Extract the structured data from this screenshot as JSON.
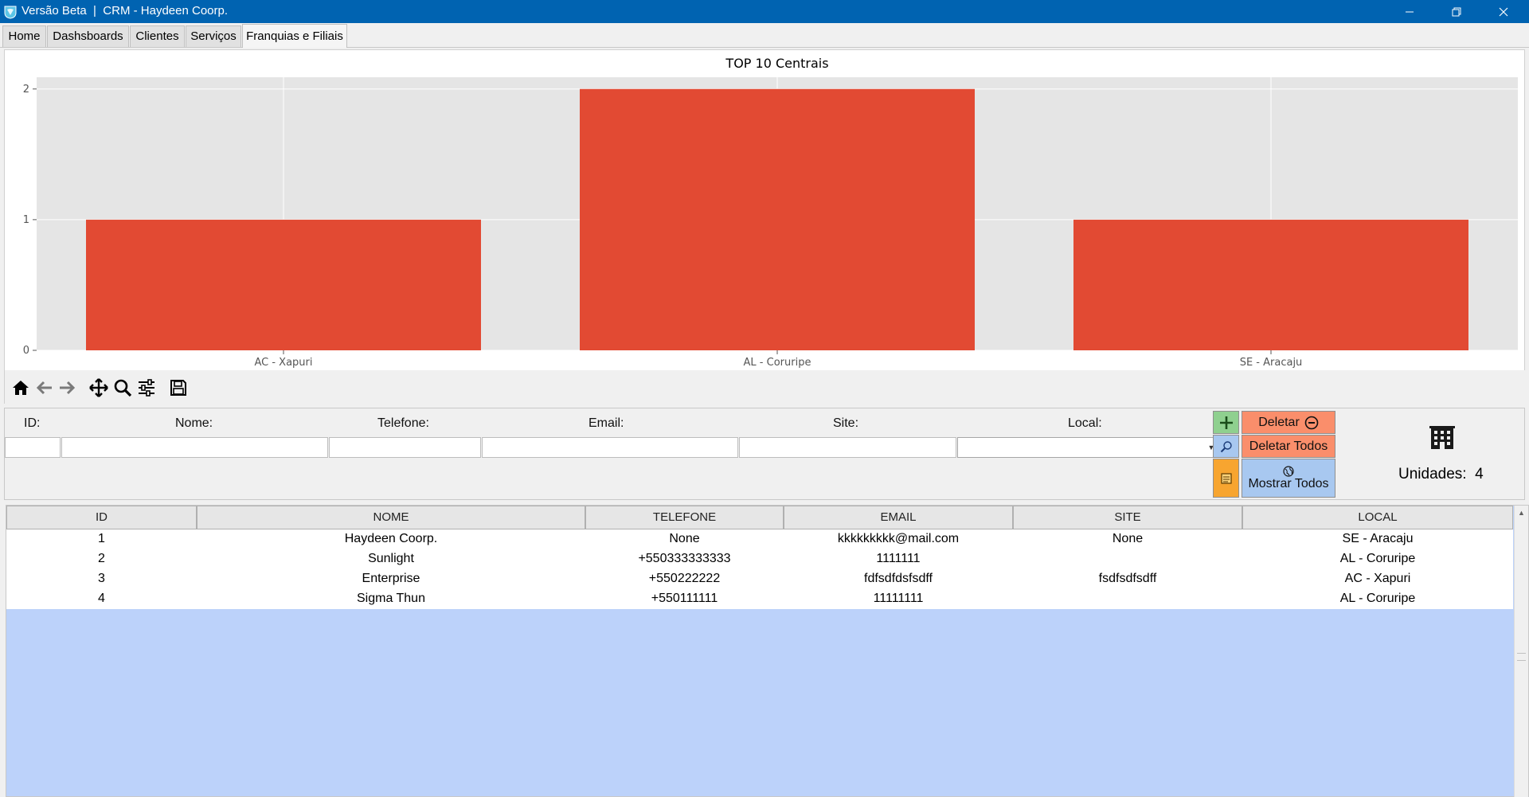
{
  "window": {
    "title": "Versão Beta  |  CRM - Haydeen Coorp.",
    "controls": [
      "minimize",
      "restore",
      "close"
    ]
  },
  "tabs": [
    {
      "label": "Home",
      "active": false
    },
    {
      "label": "Dashsboards",
      "active": false
    },
    {
      "label": "Clientes",
      "active": false
    },
    {
      "label": "Serviços",
      "active": false
    },
    {
      "label": "Franquias e Filiais",
      "active": true
    }
  ],
  "chart_data": {
    "type": "bar",
    "title": "TOP 10 Centrais",
    "categories": [
      "AC - Xapuri",
      "AL - Coruripe",
      "SE - Aracaju"
    ],
    "values": [
      1,
      2,
      1
    ],
    "yticks": [
      "0",
      "1",
      "2"
    ],
    "ylim": [
      0,
      2.09
    ],
    "xlabel": "",
    "ylabel": "",
    "grid": true,
    "bar_color": "#e24a33",
    "plot_background": "#e5e5e5"
  },
  "toolbar": {
    "icons": [
      "home-icon",
      "back-arrow-icon",
      "forward-arrow-icon",
      "pan-icon",
      "zoom-icon",
      "configure-subplots-icon",
      "save-icon"
    ]
  },
  "form": {
    "labels": {
      "id": "ID:",
      "nome": "Nome:",
      "telefone": "Telefone:",
      "email": "Email:",
      "site": "Site:",
      "local": "Local:"
    },
    "values": {
      "id": "",
      "nome": "",
      "telefone": "",
      "email": "",
      "site": "",
      "local": ""
    },
    "buttons": {
      "deletar": "Deletar",
      "deletar_todos": "Deletar Todos",
      "mostrar_todos": "Mostrar Todos"
    },
    "unidades_label": "Unidades:",
    "unidades_count": "4"
  },
  "colors": {
    "titlebar": "#0063b1",
    "add_button": "#8fd08f",
    "delete_button": "#fa8e6b",
    "search_button": "#a8c8f0",
    "form_button": "#f7a530",
    "table_empty_area": "#bcd2fa"
  },
  "table": {
    "columns": [
      "ID",
      "NOME",
      "TELEFONE",
      "EMAIL",
      "SITE",
      "LOCAL"
    ],
    "rows": [
      [
        "1",
        "Haydeen Coorp.",
        "None",
        "kkkkkkkkk@mail.com",
        "None",
        "SE - Aracaju"
      ],
      [
        "2",
        "Sunlight",
        "+550333333333",
        "1111111",
        "",
        "AL - Coruripe"
      ],
      [
        "3",
        "Enterprise",
        "+550222222",
        "fdfsdfdsfsdff",
        "fsdfsdfsdff",
        "AC - Xapuri"
      ],
      [
        "4",
        "Sigma Thun",
        "+550111111",
        "11111111",
        "",
        "AL - Coruripe"
      ]
    ]
  }
}
